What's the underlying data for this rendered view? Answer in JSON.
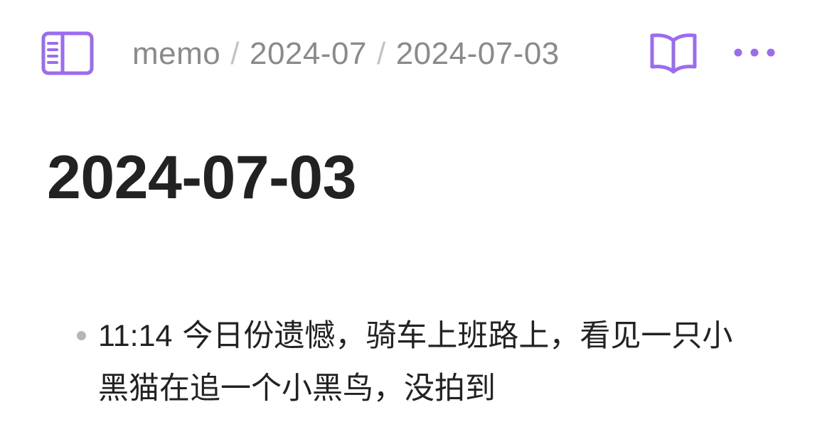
{
  "header": {
    "breadcrumb": {
      "items": [
        "memo",
        "2024-07",
        "2024-07-03"
      ],
      "separator": "/"
    },
    "icons": {
      "left": "sidebar-toggle-icon",
      "right": [
        "book-open-icon",
        "more-horizontal-icon"
      ]
    },
    "accent_color": "#9b6cf0"
  },
  "page": {
    "title": "2024-07-03"
  },
  "memos": [
    {
      "time": "11:14",
      "text": "今日份遗憾，骑车上班路上，看见一只小黑猫在追一个小黑鸟，没拍到"
    }
  ]
}
